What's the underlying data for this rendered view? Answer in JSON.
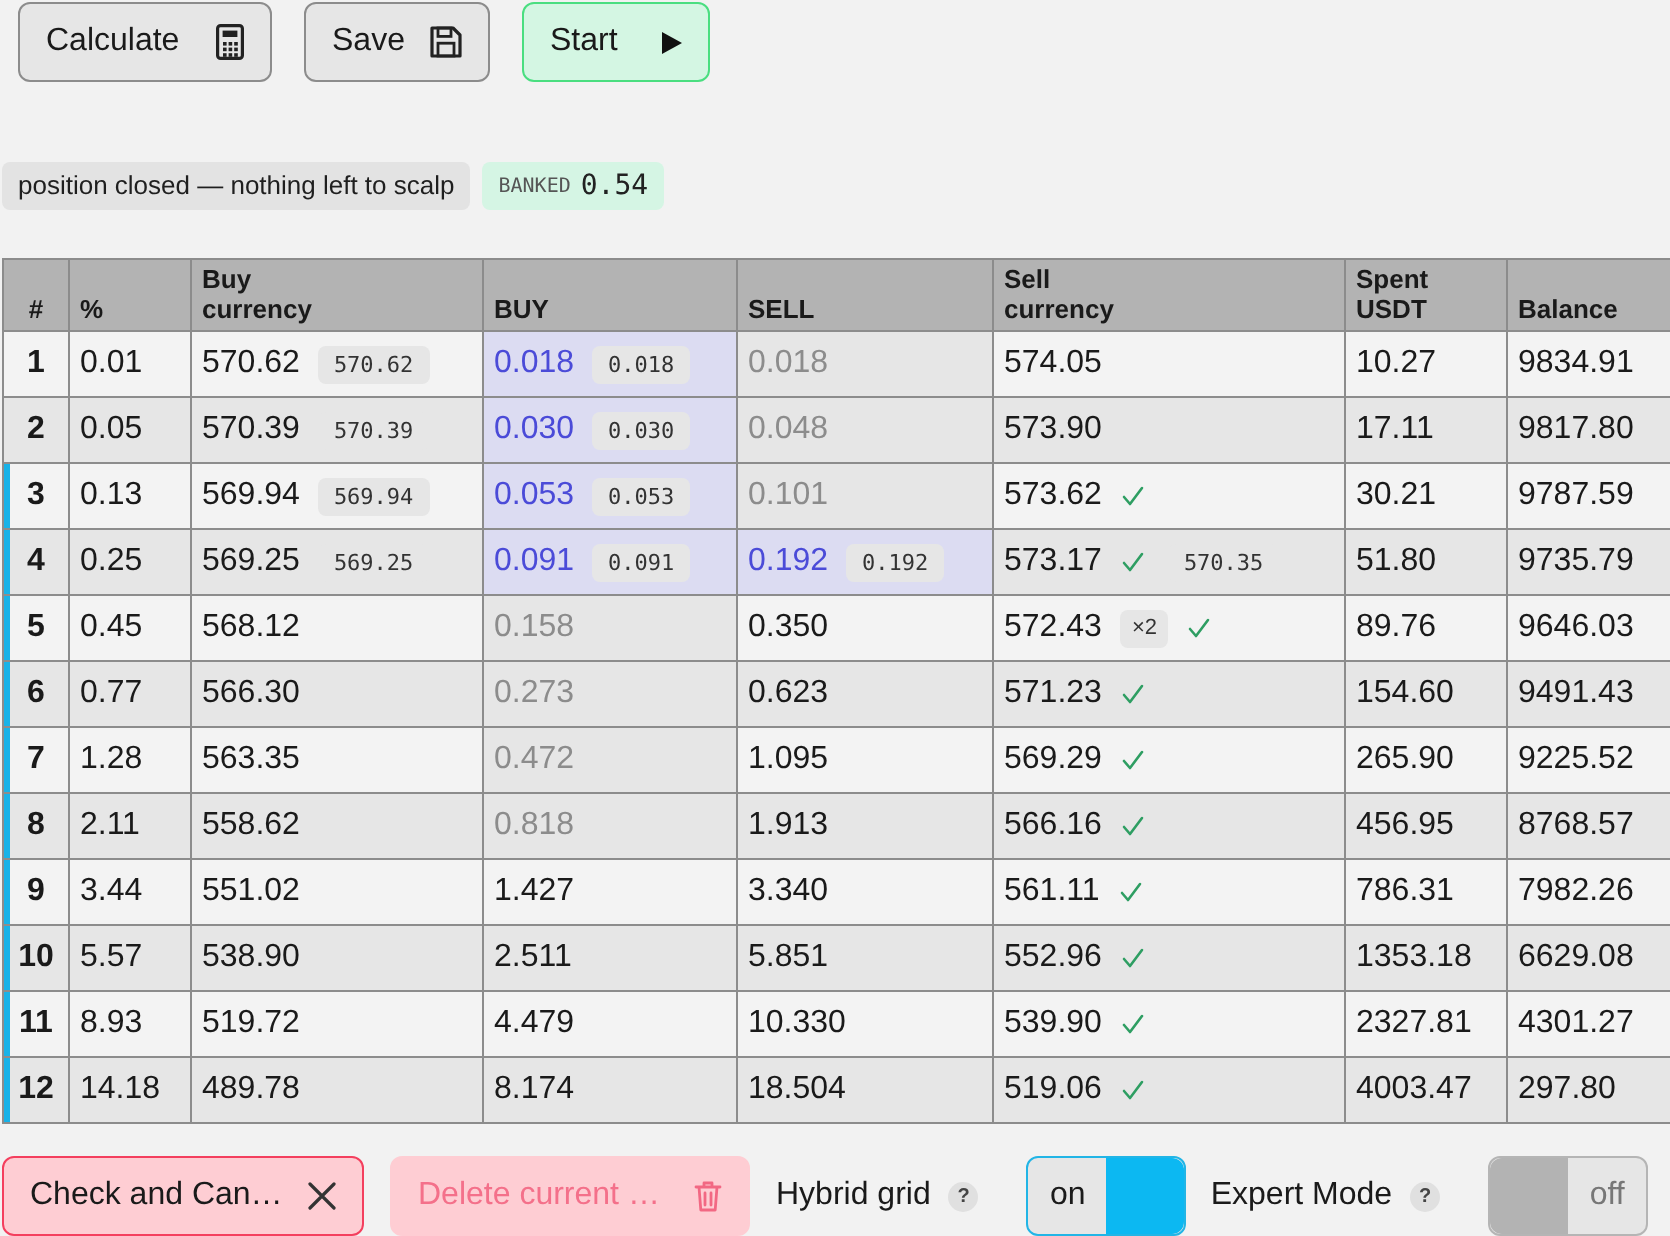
{
  "toolbar": [
    {
      "label": "Calculate",
      "kind": "calculate"
    },
    {
      "label": "Save",
      "kind": "save"
    },
    {
      "label": "Start",
      "kind": "start"
    }
  ],
  "status": {
    "message": "position closed — nothing left to scalp",
    "banked_label": "BANKED",
    "banked_value": "0.54"
  },
  "table": {
    "columns": [
      "#",
      "%",
      "Buy\ncurrency",
      "BUY",
      "SELL",
      "Sell\ncurrency",
      "Spent\nUSDT",
      "Balance"
    ],
    "rows": [
      {
        "num": "1",
        "pct": "0.01",
        "buy_price": {
          "value": "570.62",
          "tag": "570.62"
        },
        "buy": {
          "value": "0.018",
          "tag": "0.018",
          "highlighted": true,
          "dimmed": false
        },
        "sell": {
          "value": "0.018",
          "highlighted": false,
          "dimmed": true
        },
        "sell_price": {
          "value": "574.05",
          "checked": false
        },
        "spent": "10.27",
        "balance": "9834.91",
        "marked": false
      },
      {
        "num": "2",
        "pct": "0.05",
        "buy_price": {
          "value": "570.39",
          "tag": "570.39"
        },
        "buy": {
          "value": "0.030",
          "tag": "0.030",
          "highlighted": true,
          "dimmed": false
        },
        "sell": {
          "value": "0.048",
          "highlighted": false,
          "dimmed": true
        },
        "sell_price": {
          "value": "573.90",
          "checked": false
        },
        "spent": "17.11",
        "balance": "9817.80",
        "marked": false
      },
      {
        "num": "3",
        "pct": "0.13",
        "buy_price": {
          "value": "569.94",
          "tag": "569.94"
        },
        "buy": {
          "value": "0.053",
          "tag": "0.053",
          "highlighted": true,
          "dimmed": false
        },
        "sell": {
          "value": "0.101",
          "highlighted": false,
          "dimmed": true
        },
        "sell_price": {
          "value": "573.62",
          "checked": true
        },
        "spent": "30.21",
        "balance": "9787.59",
        "marked": true
      },
      {
        "num": "4",
        "pct": "0.25",
        "buy_price": {
          "value": "569.25",
          "tag": "569.25"
        },
        "buy": {
          "value": "0.091",
          "tag": "0.091",
          "highlighted": true,
          "dimmed": false
        },
        "sell": {
          "value": "0.192",
          "tag": "0.192",
          "highlighted": true,
          "dimmed": false
        },
        "sell_price": {
          "value": "573.17",
          "checked": true,
          "note": "570.35"
        },
        "spent": "51.80",
        "balance": "9735.79",
        "marked": true
      },
      {
        "num": "5",
        "pct": "0.45",
        "buy_price": {
          "value": "568.12"
        },
        "buy": {
          "value": "0.158",
          "highlighted": false,
          "dimmed": true
        },
        "sell": {
          "value": "0.350",
          "highlighted": false,
          "dimmed": false
        },
        "sell_price": {
          "value": "572.43",
          "multiplier": "×2",
          "checked": true
        },
        "spent": "89.76",
        "balance": "9646.03",
        "marked": true
      },
      {
        "num": "6",
        "pct": "0.77",
        "buy_price": {
          "value": "566.30"
        },
        "buy": {
          "value": "0.273",
          "highlighted": false,
          "dimmed": true
        },
        "sell": {
          "value": "0.623",
          "highlighted": false,
          "dimmed": false
        },
        "sell_price": {
          "value": "571.23",
          "checked": true
        },
        "spent": "154.60",
        "balance": "9491.43",
        "marked": true
      },
      {
        "num": "7",
        "pct": "1.28",
        "buy_price": {
          "value": "563.35"
        },
        "buy": {
          "value": "0.472",
          "highlighted": false,
          "dimmed": true
        },
        "sell": {
          "value": "1.095",
          "highlighted": false,
          "dimmed": false
        },
        "sell_price": {
          "value": "569.29",
          "checked": true
        },
        "spent": "265.90",
        "balance": "9225.52",
        "marked": true
      },
      {
        "num": "8",
        "pct": "2.11",
        "buy_price": {
          "value": "558.62"
        },
        "buy": {
          "value": "0.818",
          "highlighted": false,
          "dimmed": true
        },
        "sell": {
          "value": "1.913",
          "highlighted": false,
          "dimmed": false
        },
        "sell_price": {
          "value": "566.16",
          "checked": true
        },
        "spent": "456.95",
        "balance": "8768.57",
        "marked": true
      },
      {
        "num": "9",
        "pct": "3.44",
        "buy_price": {
          "value": "551.02"
        },
        "buy": {
          "value": "1.427",
          "highlighted": false,
          "dimmed": false
        },
        "sell": {
          "value": "3.340",
          "highlighted": false,
          "dimmed": false
        },
        "sell_price": {
          "value": "561.11",
          "checked": true
        },
        "spent": "786.31",
        "balance": "7982.26",
        "marked": true
      },
      {
        "num": "10",
        "pct": "5.57",
        "buy_price": {
          "value": "538.90"
        },
        "buy": {
          "value": "2.511",
          "highlighted": false,
          "dimmed": false
        },
        "sell": {
          "value": "5.851",
          "highlighted": false,
          "dimmed": false
        },
        "sell_price": {
          "value": "552.96",
          "checked": true
        },
        "spent": "1353.18",
        "balance": "6629.08",
        "marked": true
      },
      {
        "num": "11",
        "pct": "8.93",
        "buy_price": {
          "value": "519.72"
        },
        "buy": {
          "value": "4.479",
          "highlighted": false,
          "dimmed": false
        },
        "sell": {
          "value": "10.330",
          "highlighted": false,
          "dimmed": false
        },
        "sell_price": {
          "value": "539.90",
          "checked": true
        },
        "spent": "2327.81",
        "balance": "4301.27",
        "marked": true
      },
      {
        "num": "12",
        "pct": "14.18",
        "buy_price": {
          "value": "489.78"
        },
        "buy": {
          "value": "8.174",
          "highlighted": false,
          "dimmed": false
        },
        "sell": {
          "value": "18.504",
          "highlighted": false,
          "dimmed": false
        },
        "sell_price": {
          "value": "519.06",
          "checked": true
        },
        "spent": "4003.47",
        "balance": "297.80",
        "marked": true
      }
    ]
  },
  "actions": [
    {
      "label": "Check and Can…",
      "kind": "cancel",
      "disabled": false
    },
    {
      "label": "Delete current …",
      "kind": "delete",
      "disabled": true
    }
  ],
  "switches": [
    {
      "label": "Hybrid grid",
      "hint": "?",
      "on": true,
      "state_label": "on"
    },
    {
      "label": "Expert Mode",
      "hint": "?",
      "on": false,
      "state_label": "off"
    }
  ]
}
